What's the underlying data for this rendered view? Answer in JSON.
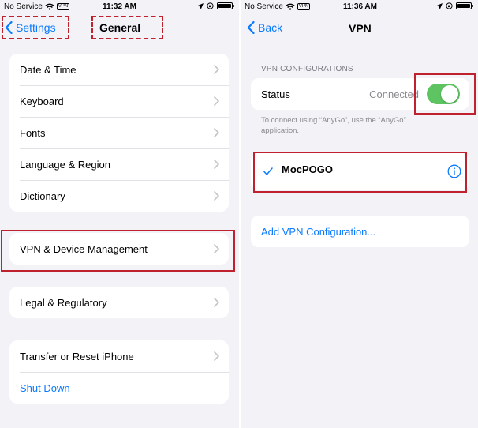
{
  "left": {
    "status_bar": {
      "carrier": "No Service",
      "vpn_badge": "VPN",
      "time": "11:32 AM"
    },
    "nav": {
      "back_label": "Settings",
      "title": "General"
    },
    "groups": [
      {
        "items": [
          {
            "label": "Date & Time"
          },
          {
            "label": "Keyboard"
          },
          {
            "label": "Fonts"
          },
          {
            "label": "Language & Region"
          },
          {
            "label": "Dictionary"
          }
        ]
      },
      {
        "items": [
          {
            "label": "VPN & Device Management"
          }
        ]
      },
      {
        "items": [
          {
            "label": "Legal & Regulatory"
          }
        ]
      },
      {
        "items": [
          {
            "label": "Transfer or Reset iPhone"
          },
          {
            "label": "Shut Down"
          }
        ]
      }
    ]
  },
  "right": {
    "status_bar": {
      "carrier": "No Service",
      "vpn_badge": "VPN",
      "time": "11:36 AM"
    },
    "nav": {
      "back_label": "Back",
      "title": "VPN"
    },
    "section_header": "VPN CONFIGURATIONS",
    "status_row": {
      "label": "Status",
      "value": "Connected",
      "toggle_on": true
    },
    "footnote_line1": "To connect using “AnyGo”, use the “AnyGo”",
    "footnote_line2": "application.",
    "vpn_item": {
      "name": "MocPOGO",
      "checked": true
    },
    "add_config_label": "Add VPN Configuration..."
  },
  "colors": {
    "accent": "#0a7aff",
    "toggle_on": "#5ec461",
    "highlight": "#c0212f",
    "background": "#f2f2f7"
  }
}
